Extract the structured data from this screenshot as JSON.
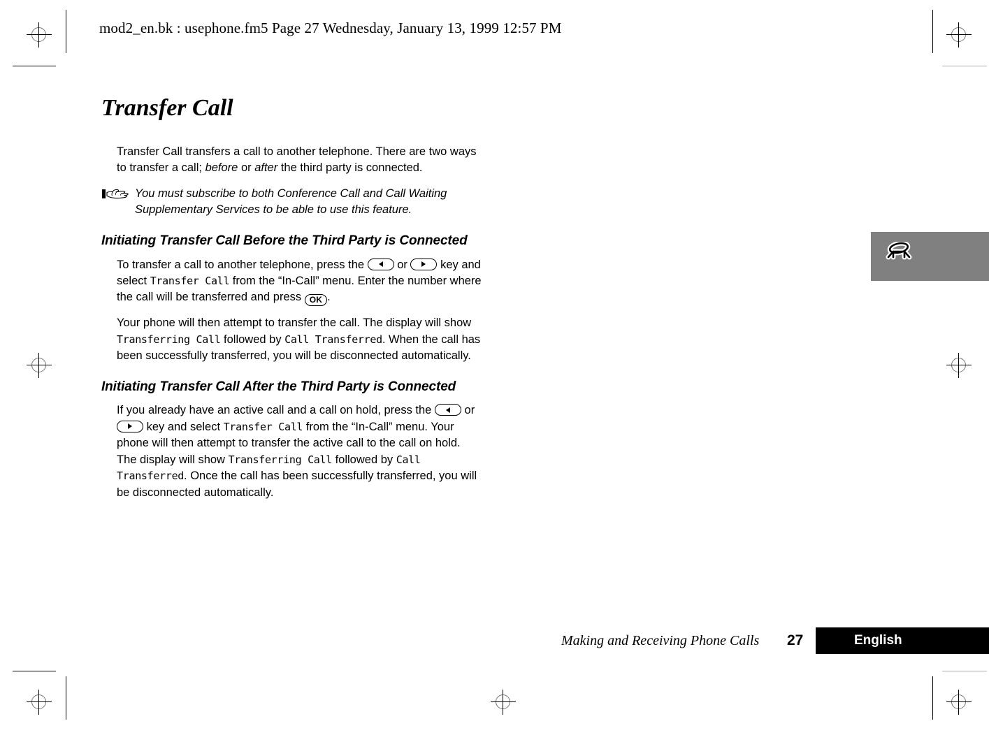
{
  "doc": {
    "header_line": "mod2_en.bk : usephone.fm5  Page 27  Wednesday, January 13, 1999  12:57 PM",
    "title": "Transfer Call"
  },
  "intro": {
    "part1": "Transfer Call transfers a call to another telephone. There are two ways to transfer a call; ",
    "em1": "before",
    "part2": " or ",
    "em2": "after",
    "part3": " the third party is connected."
  },
  "note": {
    "icon": "pointing-hand-icon",
    "text": "You must subscribe to both Conference Call and Call Waiting Supplementary Services to be able to use this feature."
  },
  "section_before": {
    "heading": "Initiating Transfer Call Before the Third Party is Connected",
    "p1": {
      "t1": "To transfer a call to another telephone, press the ",
      "key_left": "left-arrow-key",
      "t2": " or ",
      "key_right": "right-arrow-key",
      "t3": " key and select ",
      "lcd1": "Transfer Call",
      "t4": " from the “In-Call” menu. Enter the number where the call will be transferred and press ",
      "key_ok": "OK",
      "t5": "."
    },
    "p2": {
      "t1": "Your phone will then attempt to transfer the call. The display will show ",
      "lcd1": "Transferring Call",
      "t2": " followed by ",
      "lcd2": "Call Transferred",
      "t3": ". When the call has been successfully transferred, you will be disconnected automatically."
    }
  },
  "section_after": {
    "heading": "Initiating Transfer Call After the Third Party is Connected",
    "p1": {
      "t1": "If you already have an active call and a call on hold, press the ",
      "key_left": "left-arrow-key",
      "t2": " or ",
      "key_right": "right-arrow-key",
      "t3": " key and select ",
      "lcd1": "Transfer Call",
      "t4": " from the “In-Call” menu. Your phone will then attempt to transfer the active call to the call on hold. The display will show ",
      "lcd2": "Transferring Call",
      "t5": " followed by ",
      "lcd3": "Call Transferred",
      "t6": ". Once the call has been successfully transferred, you will be disconnected automatically."
    }
  },
  "thumb_tab": {
    "icon": "telephone-handset-icon",
    "background_color": "#808080"
  },
  "footer": {
    "section_title": "Making and Receiving Phone Calls",
    "page_number": "27",
    "language": "English",
    "bar_color": "#000000"
  }
}
